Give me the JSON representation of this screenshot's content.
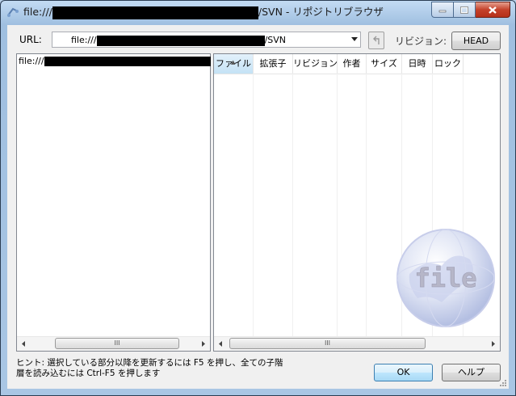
{
  "window": {
    "title_prefix": "file:///",
    "title_suffix": "/SVN - リポジトリブラウザ"
  },
  "toolbar": {
    "url_label": "URL:",
    "url_prefix": "file:///",
    "url_suffix": "/SVN",
    "revision_label": "リビジョン:",
    "head_button": "HEAD"
  },
  "tree": {
    "root_prefix": "file:///"
  },
  "list": {
    "columns": [
      "ファイル",
      "拡張子",
      "リビジョン",
      "作者",
      "サイズ",
      "日時",
      "ロック"
    ],
    "sorted_column": "ファイル",
    "watermark_text": "file"
  },
  "hint": {
    "line1": "ヒント: 選択している部分以降を更新するには F5 を押し、全ての子階",
    "line2": "層を読み込むには Ctrl-F5 を押します"
  },
  "buttons": {
    "ok": "OK",
    "help": "ヘルプ"
  },
  "scrollbar_grip": "III",
  "icons": [
    "repo-browser-icon",
    "minimize-icon",
    "maximize-icon",
    "close-icon",
    "dropdown-arrow-icon",
    "up-folder-icon",
    "scroll-left-icon",
    "scroll-right-icon",
    "globe-watermark-icon",
    "resize-grip-icon"
  ]
}
